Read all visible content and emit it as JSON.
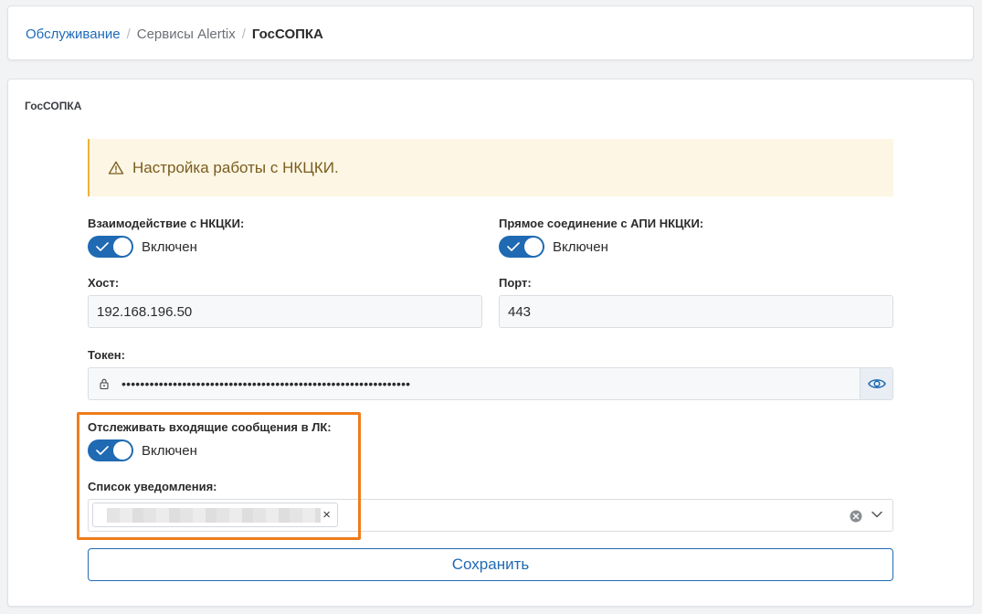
{
  "breadcrumb": {
    "items": [
      "Обслуживание",
      "Сервисы Alertix",
      "ГосСОПКА"
    ],
    "separator": "/"
  },
  "section": {
    "title": "ГосСОПКА"
  },
  "alert": {
    "text": "Настройка работы с НКЦКИ.",
    "icon": "warning-icon"
  },
  "interaction": {
    "label": "Взаимодействие с НКЦКИ:",
    "state": "Включен",
    "enabled": true
  },
  "direct_api": {
    "label": "Прямое соединение с АПИ НКЦКИ:",
    "state": "Включен",
    "enabled": true
  },
  "host": {
    "label": "Хост:",
    "value": "192.168.196.50"
  },
  "port": {
    "label": "Порт:",
    "value": "443"
  },
  "token": {
    "label": "Токен:",
    "value": "••••••••••••••••••••••••••••••••••••••••••••••••••••••••••••••",
    "lock_icon": "lock-icon",
    "reveal_icon": "eye-icon"
  },
  "track_messages": {
    "label": "Отслеживать входящие сообщения в ЛК:",
    "state": "Включен",
    "enabled": true
  },
  "notification_list": {
    "label": "Список уведомления:",
    "chip_remove": "×"
  },
  "save_button": {
    "label": "Сохранить"
  },
  "colors": {
    "accent": "#1f6ab3",
    "highlight": "#ef7c1b",
    "alert_bg": "#fdf6e4",
    "alert_border": "#f0b23a"
  }
}
